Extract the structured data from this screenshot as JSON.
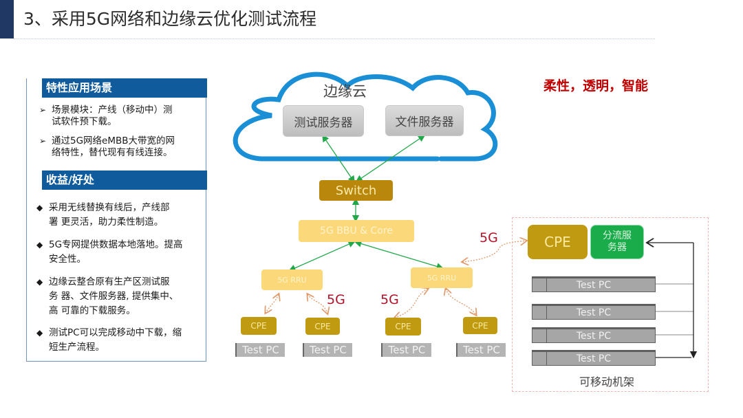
{
  "header": {
    "title": "3、采用5G网络和边缘云优化测试流程"
  },
  "left_panel": {
    "scenario": {
      "heading": "特性应用场景",
      "items": [
        {
          "line1": "场景模块：产线（移动中）测",
          "line2": "试软件预下载。"
        },
        {
          "line1": "通过5G网络eMBB大带宽的网",
          "line2": "络特性，替代现有有线连接。"
        }
      ]
    },
    "benefits": {
      "heading": "收益/好处",
      "items": [
        {
          "lines": [
            "采用无线替换有线后，产线部",
            "署 更灵活，助力柔性制造。"
          ]
        },
        {
          "lines": [
            "5G专网提供数据本地落地。提高",
            "安全性。"
          ]
        },
        {
          "lines": [
            "边缘云整合原有生产区测试服",
            "务 器、文件服务器, 提供集中、",
            "高 可靠的下载服务。"
          ]
        },
        {
          "lines": [
            "测试PC可以完成移动中下载，缩",
            "短生产流程。"
          ]
        }
      ]
    },
    "bullet_arrow": "➢",
    "bullet_diamond": "◆"
  },
  "diagram": {
    "slogan": "柔性，透明，智能",
    "cloud": {
      "label": "边缘云",
      "servers": [
        "测试服务器",
        "文件服务器"
      ]
    },
    "switch": "Switch",
    "bbu": "5G BBU & Core",
    "rru": [
      "5G RRU",
      "5G RRU"
    ],
    "cpe_small": [
      "CPE",
      "CPE",
      "CPE",
      "CPE"
    ],
    "test_pc_small": [
      "Test PC",
      "Test PC",
      "Test PC",
      "Test PC"
    ],
    "label_5g": [
      "5G",
      "5G",
      "5G"
    ],
    "rack": {
      "cpe": "CPE",
      "shunt_server_line1": "分流服",
      "shunt_server_line2": "务器",
      "pcs": [
        "Test PC",
        "Test PC",
        "Test PC",
        "Test PC"
      ],
      "caption": "可移动机架"
    },
    "colors": {
      "cloud": "#1a8fd6",
      "wired_link": "#22a84a",
      "wireless_link": "#e09a6a",
      "accent_red": "#c00000"
    }
  }
}
